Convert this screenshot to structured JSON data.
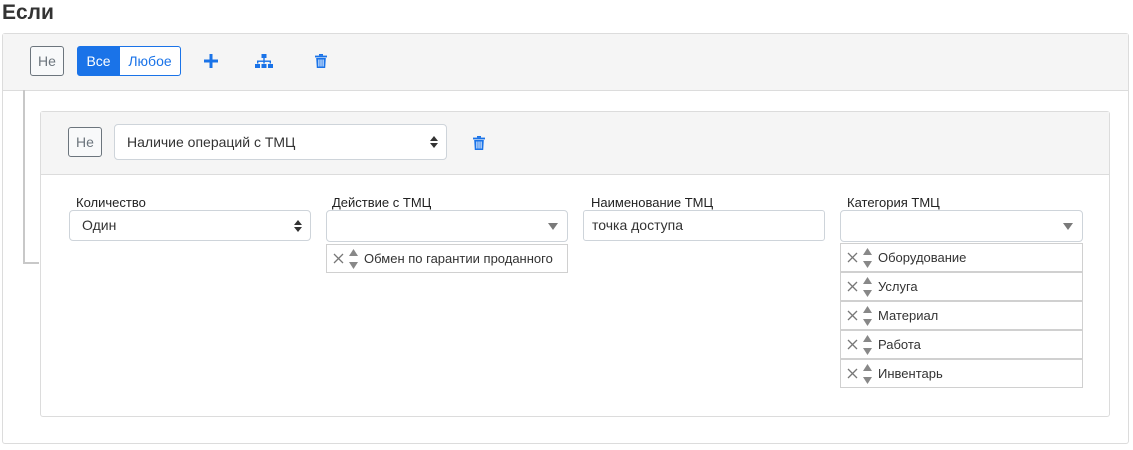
{
  "page": {
    "title": "Если"
  },
  "group": {
    "not_label": "Не",
    "all_label": "Все",
    "any_label": "Любое",
    "icons": [
      "plus-icon",
      "sitemap-icon",
      "trash-icon"
    ],
    "accent_color": "#1a73e8"
  },
  "rule": {
    "not_label": "Не",
    "condition_value": "Наличие операций с ТМЦ",
    "fields": {
      "quantity": {
        "label": "Количество",
        "value": "Один"
      },
      "action": {
        "label": "Действие с ТМЦ",
        "selected": [
          "Обмен по гарантии проданного"
        ]
      },
      "name": {
        "label": "Наименование ТМЦ",
        "value": "точка доступа"
      },
      "category": {
        "label": "Категория ТМЦ",
        "selected": [
          "Оборудование",
          "Услуга",
          "Материал",
          "Работа",
          "Инвентарь"
        ]
      }
    }
  }
}
